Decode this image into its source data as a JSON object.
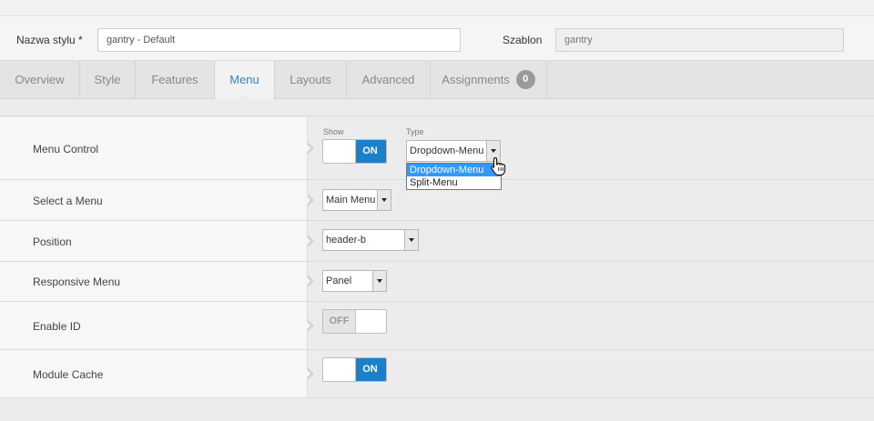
{
  "header": {
    "style_name_label": "Nazwa stylu *",
    "style_name_value": "gantry - Default",
    "template_label": "Szablon",
    "template_value": "gantry"
  },
  "tabs": [
    {
      "label": "Overview",
      "active": false
    },
    {
      "label": "Style",
      "active": false
    },
    {
      "label": "Features",
      "active": false
    },
    {
      "label": "Menu",
      "active": true
    },
    {
      "label": "Layouts",
      "active": false
    },
    {
      "label": "Advanced",
      "active": false
    },
    {
      "label": "Assignments",
      "active": false,
      "badge": "0"
    }
  ],
  "rows": {
    "menu_control": {
      "label": "Menu Control",
      "show_label": "Show",
      "show_state": "ON",
      "type_label": "Type",
      "type_value": "Dropdown-Menu",
      "type_options": [
        "Dropdown-Menu",
        "Split-Menu"
      ]
    },
    "select_menu": {
      "label": "Select a Menu",
      "value": "Main Menu"
    },
    "position": {
      "label": "Position",
      "value": "header-b"
    },
    "responsive_menu": {
      "label": "Responsive Menu",
      "value": "Panel"
    },
    "enable_id": {
      "label": "Enable ID",
      "state": "OFF"
    },
    "module_cache": {
      "label": "Module Cache",
      "state": "ON"
    }
  },
  "colors": {
    "accent": "#1b7fcc",
    "active_tab_text": "#2d86c8",
    "highlight": "#3399ff"
  }
}
